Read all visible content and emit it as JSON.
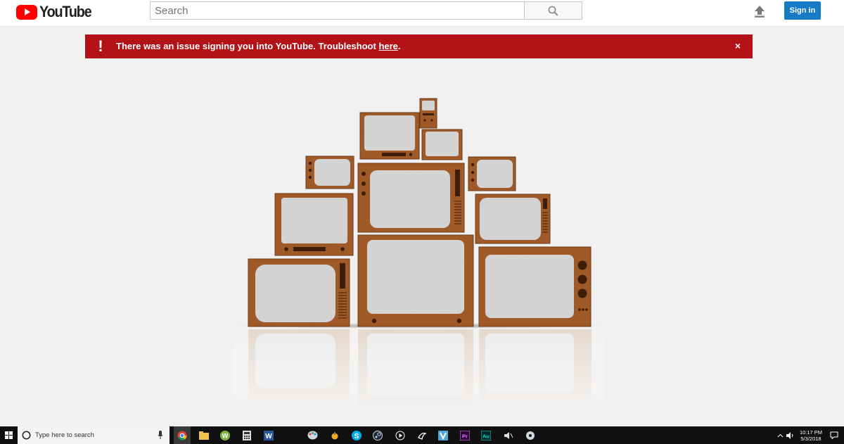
{
  "header": {
    "logo_text": "YouTube",
    "search_placeholder": "Search",
    "signin_label": "Sign in"
  },
  "alert": {
    "message": "There was an issue signing you into YouTube. Troubleshoot ",
    "link_text": "here",
    "trailing": ".",
    "close_symbol": "×"
  },
  "taskbar": {
    "search_placeholder": "Type here to search",
    "time": "10:17 PM",
    "date": "5/3/2018",
    "apps": [
      "Chrome",
      "File Explorer",
      "W",
      "Calculator",
      "W",
      "Paint",
      "Folder",
      "Skype",
      "Steam",
      "Media",
      "Inkscape",
      "Visual Studio",
      "Pr",
      "Au",
      "Sound",
      "Disc"
    ]
  },
  "colors": {
    "brand_red": "#ff0000",
    "alert_red": "#b31217",
    "signin_blue": "#167ac6",
    "tv_wood": "#a05a28",
    "taskbar": "#101010"
  }
}
